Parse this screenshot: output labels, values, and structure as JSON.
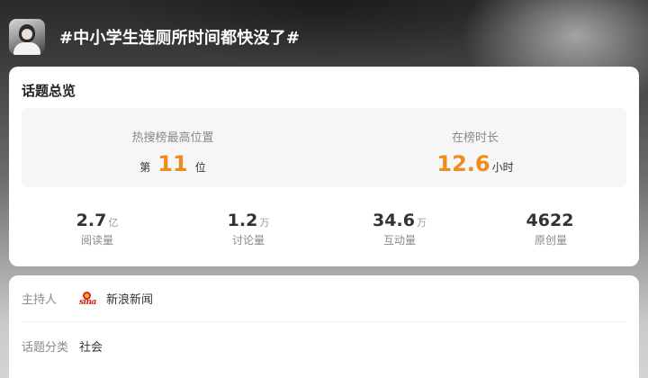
{
  "header": {
    "title": "#中小学生连厕所时间都快没了#",
    "avatar_icon": "user-avatar"
  },
  "overview": {
    "title": "话题总览",
    "highest_rank": {
      "label": "热搜榜最高位置",
      "prefix": "第",
      "value": "11",
      "suffix": "位"
    },
    "duration": {
      "label": "在榜时长",
      "value": "12.6",
      "suffix": "小时"
    },
    "accent_color": "#f08c1e",
    "metrics": [
      {
        "value": "2.7",
        "unit": "亿",
        "label": "阅读量"
      },
      {
        "value": "1.2",
        "unit": "万",
        "label": "讨论量"
      },
      {
        "value": "34.6",
        "unit": "万",
        "label": "互动量"
      },
      {
        "value": "4622",
        "unit": "",
        "label": "原创量"
      }
    ]
  },
  "info": {
    "host_label": "主持人",
    "host_icon": "sina-logo",
    "host_logo_text": "sina",
    "host_name": "新浪新闻",
    "category_label": "话题分类",
    "category_value": "社会"
  }
}
